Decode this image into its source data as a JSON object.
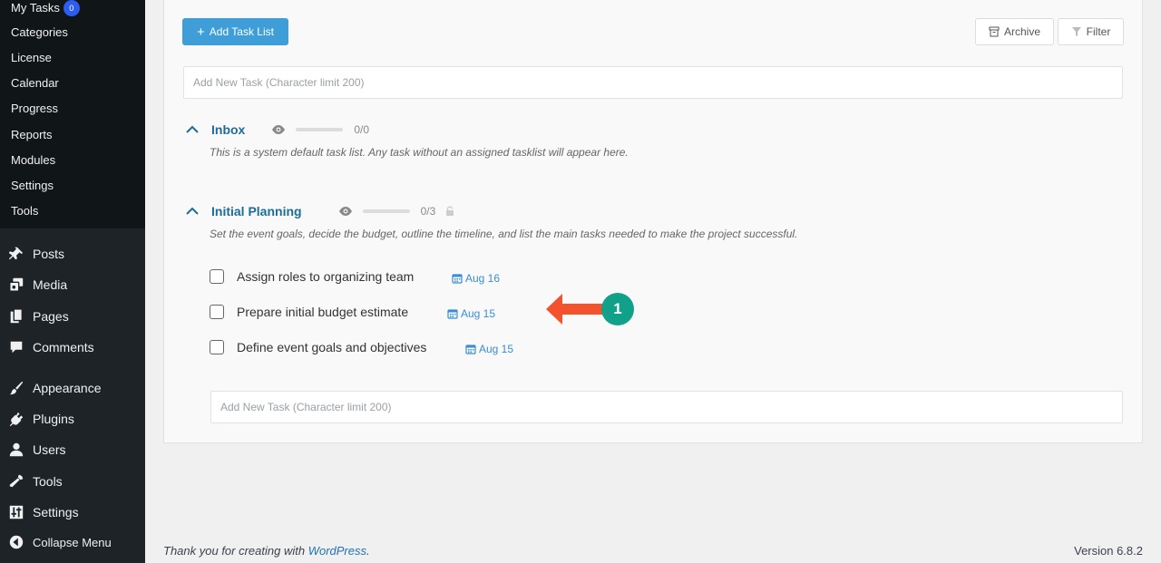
{
  "sidebar": {
    "submenu": [
      {
        "label": "My Tasks",
        "badge": "0"
      },
      {
        "label": "Categories"
      },
      {
        "label": "License"
      },
      {
        "label": "Calendar"
      },
      {
        "label": "Progress"
      },
      {
        "label": "Reports"
      },
      {
        "label": "Modules"
      },
      {
        "label": "Settings"
      },
      {
        "label": "Tools"
      }
    ],
    "menu": [
      {
        "label": "Posts",
        "icon": "pin-icon"
      },
      {
        "label": "Media",
        "icon": "media-icon"
      },
      {
        "label": "Pages",
        "icon": "pages-icon"
      },
      {
        "label": "Comments",
        "icon": "comment-icon"
      },
      {
        "label": "Appearance",
        "icon": "brush-icon"
      },
      {
        "label": "Plugins",
        "icon": "plug-icon"
      },
      {
        "label": "Users",
        "icon": "user-icon"
      },
      {
        "label": "Tools",
        "icon": "wrench-icon"
      },
      {
        "label": "Settings",
        "icon": "sliders-icon"
      },
      {
        "label": "Collapse Menu",
        "icon": "collapse-icon"
      }
    ]
  },
  "toolbar": {
    "add_task_list": "Add Task List",
    "add_task_list_icon": "+",
    "archive": "Archive",
    "filter": "Filter"
  },
  "new_task_placeholder": "Add New Task (Character limit 200)",
  "lists": [
    {
      "title": "Inbox",
      "progress": "0/0",
      "completed": 0,
      "total": 0,
      "description": "This is a system default task list. Any task without an assigned tasklist will appear here."
    },
    {
      "title": "Initial Planning",
      "progress": "0/3",
      "completed": 0,
      "total": 3,
      "description": "Set the event goals, decide the budget, outline the timeline, and list the main tasks needed to make the project successful.",
      "tasks": [
        {
          "title": "Assign roles to organizing team",
          "due": "Aug 16"
        },
        {
          "title": "Prepare initial budget estimate",
          "due": "Aug 15"
        },
        {
          "title": "Define event goals and objectives",
          "due": "Aug 15"
        }
      ]
    }
  ],
  "annotation": {
    "marker": "1",
    "color": "#11a08a",
    "arrow_color": "#f4522d"
  },
  "footer": {
    "thanks_prefix": "Thank you for creating with ",
    "link": "WordPress",
    "thanks_suffix": ".",
    "version": "Version 6.8.2"
  },
  "colors": {
    "sidebar": "#1d2327",
    "accent_button": "#3f9ed8",
    "link": "#1e6c98"
  }
}
